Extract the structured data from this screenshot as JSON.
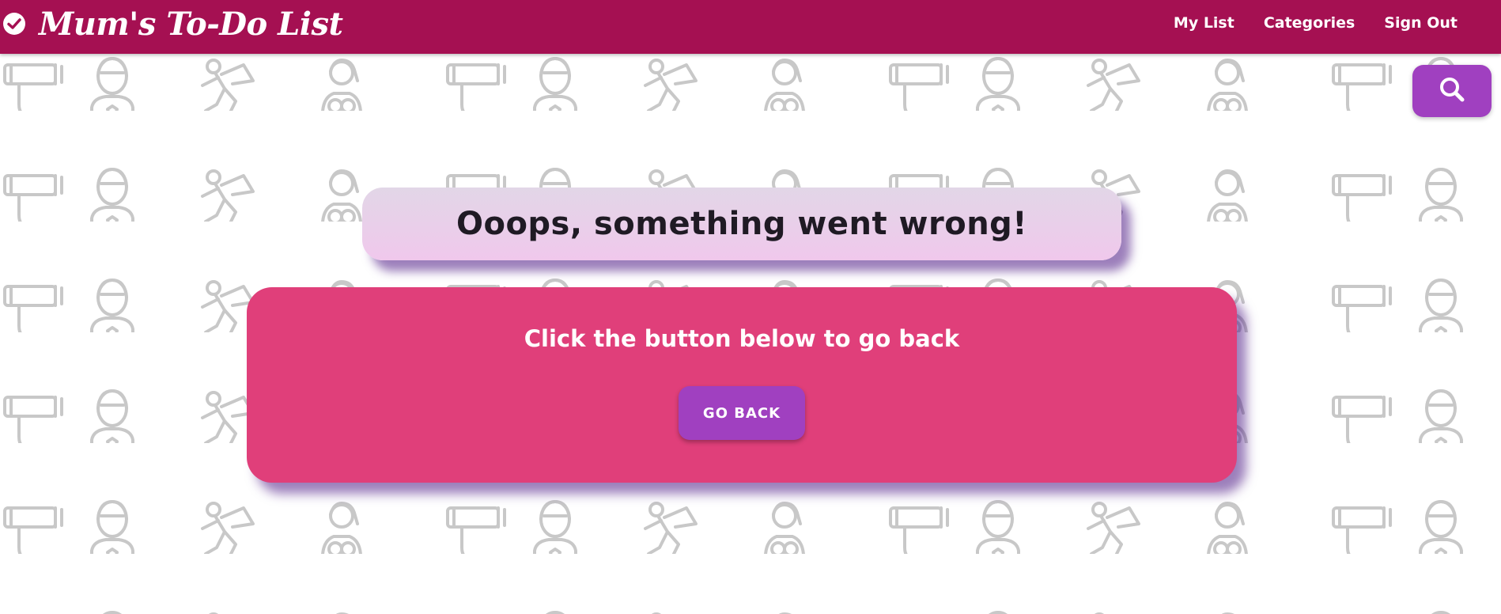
{
  "navbar": {
    "brand_title": "Mum's To-Do List",
    "brand_icon": "check-circle-icon",
    "links": [
      {
        "label": "My List"
      },
      {
        "label": "Categories"
      },
      {
        "label": "Sign Out"
      }
    ],
    "background_color": "#a51052"
  },
  "search": {
    "icon": "search-icon",
    "button_color": "#a040c0"
  },
  "error": {
    "heading": "Ooops, something went wrong!",
    "message": "Click the button below to go back",
    "button_label": "GO BACK",
    "panel_color": "#e03f7a"
  },
  "background": {
    "pattern": "superhero-mum-line-icons",
    "pattern_color": "#c8c8c8"
  }
}
